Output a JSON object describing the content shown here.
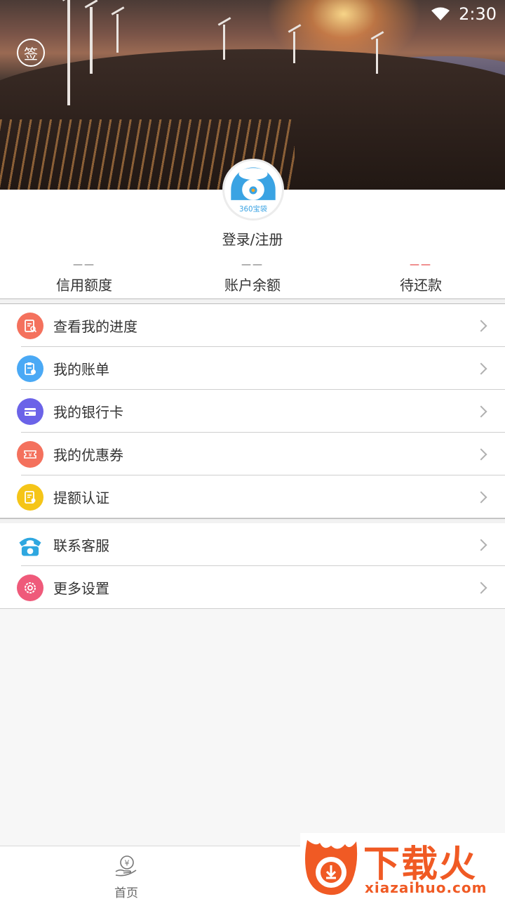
{
  "status_bar": {
    "time": "2:30",
    "wifi_icon": "wifi-icon"
  },
  "header": {
    "sign_label": "签",
    "sign_icon": "sign-in-icon"
  },
  "profile": {
    "login_label": "登录/注册",
    "avatar_text": "360宝袋"
  },
  "stats": [
    {
      "value": "——",
      "label": "信用额度"
    },
    {
      "value": "——",
      "label": "账户余额"
    },
    {
      "value": "——",
      "label": "待还款",
      "accent": "#e02020"
    }
  ],
  "menu_group1": [
    {
      "label": "查看我的进度",
      "icon": "progress-doc-icon",
      "color": "#f4715d"
    },
    {
      "label": "我的账单",
      "icon": "bill-icon",
      "color": "#4aa9f5"
    },
    {
      "label": "我的银行卡",
      "icon": "bank-card-icon",
      "color": "#6b63e8"
    },
    {
      "label": "我的优惠券",
      "icon": "coupon-icon",
      "color": "#f4715d"
    },
    {
      "label": "提额认证",
      "icon": "certificate-icon",
      "color": "#f5c518"
    }
  ],
  "menu_group2": [
    {
      "label": "联系客服",
      "icon": "phone-icon",
      "color": "#2ea7e0"
    },
    {
      "label": "更多设置",
      "icon": "settings-icon",
      "color": "#ef5a7a"
    }
  ],
  "bottom_nav": {
    "home_label": "首页",
    "home_icon": "yen-hand-icon"
  },
  "watermark": {
    "brand": "下载火",
    "url": "xiazaihuo.com"
  }
}
